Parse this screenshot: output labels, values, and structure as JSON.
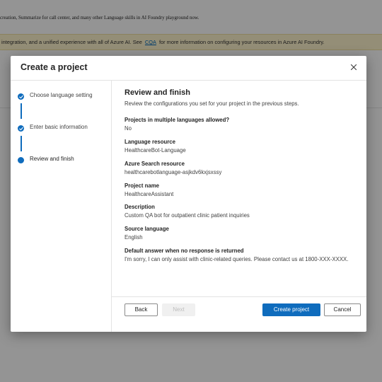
{
  "background": {
    "line1": "creation, Summarize for call center, and many other Language skills in AI Foundry playground now.",
    "banner_pre": "integration, and a unified experience with all of Azure AI. See",
    "banner_link": "CQA",
    "banner_post": "for more information on configuring your resources in Azure AI Foundry."
  },
  "dialog": {
    "title": "Create a project",
    "steps": [
      {
        "label": "Choose language setting",
        "state": "complete"
      },
      {
        "label": "Enter basic information",
        "state": "complete"
      },
      {
        "label": "Review and finish",
        "state": "current"
      }
    ],
    "heading": "Review and finish",
    "subtitle": "Review the configurations you set for your project in the previous steps.",
    "fields": [
      {
        "label": "Projects in multiple languages allowed?",
        "value": "No"
      },
      {
        "label": "Language resource",
        "value": "HealthcareBot-Language"
      },
      {
        "label": "Azure Search resource",
        "value": "healthcarebotlanguage-asjkdv6kxjsxssy"
      },
      {
        "label": "Project name",
        "value": "HealthcareAssistant"
      },
      {
        "label": "Description",
        "value": "Custom QA bot for outpatient clinic patient inquiries"
      },
      {
        "label": "Source language",
        "value": "English"
      },
      {
        "label": "Default answer when no response is returned",
        "value": "I'm sorry, I can only assist with clinic-related queries. Please contact us at 1800-XXX-XXXX."
      }
    ],
    "buttons": {
      "back": "Back",
      "next": "Next",
      "create": "Create project",
      "cancel": "Cancel"
    }
  },
  "colors": {
    "accent": "#0f6cbd",
    "banner_bg": "#fff4ce"
  },
  "icons": {
    "close": "close-icon",
    "step_complete": "checkmark-icon"
  }
}
